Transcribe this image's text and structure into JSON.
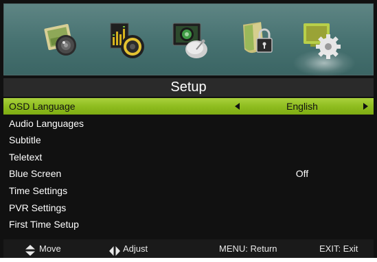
{
  "title": "Setup",
  "category_icons": [
    {
      "name": "picture-icon",
      "selected": false
    },
    {
      "name": "sound-icon",
      "selected": false
    },
    {
      "name": "channel-icon",
      "selected": false
    },
    {
      "name": "lock-icon",
      "selected": false
    },
    {
      "name": "setup-icon",
      "selected": true
    }
  ],
  "menu": {
    "items": [
      {
        "label": "OSD Language",
        "value": "English"
      },
      {
        "label": "Audio Languages",
        "value": ""
      },
      {
        "label": "Subtitle",
        "value": ""
      },
      {
        "label": "Teletext",
        "value": ""
      },
      {
        "label": "Blue Screen",
        "value": "Off"
      },
      {
        "label": "Time Settings",
        "value": ""
      },
      {
        "label": "PVR Settings",
        "value": ""
      },
      {
        "label": "First Time Setup",
        "value": ""
      }
    ]
  },
  "footer": {
    "move_label": "Move",
    "adjust_label": "Adjust",
    "return_label": "MENU: Return",
    "exit_label": "EXIT: Exit"
  },
  "colors": {
    "selection": "#8fbd20",
    "background": "#111111",
    "icon_band": "#467170"
  }
}
